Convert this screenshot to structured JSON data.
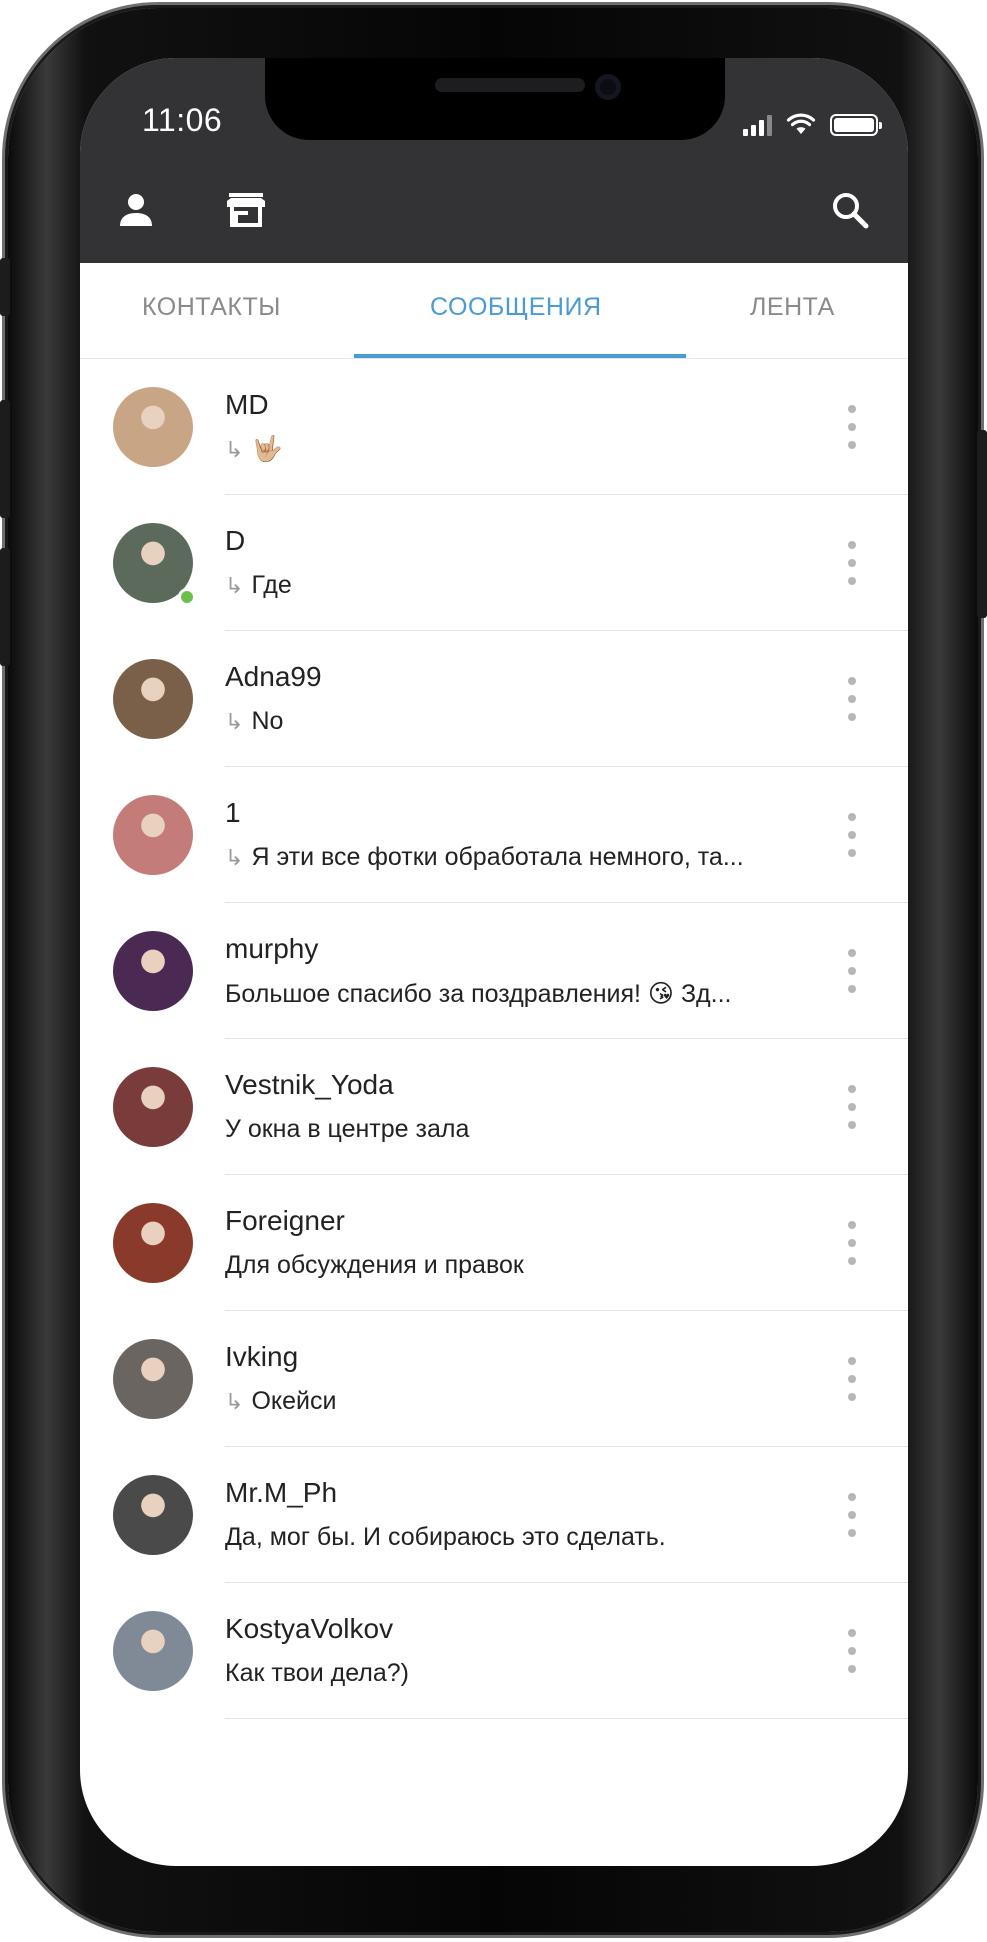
{
  "status_bar": {
    "time": "11:06"
  },
  "toolbar": {
    "profile_icon": "person-icon",
    "store_icon": "store-icon",
    "search_icon": "search-icon"
  },
  "tabs": [
    {
      "label": "КОНТАКТЫ",
      "active": false
    },
    {
      "label": "СООБЩЕНИЯ",
      "active": true
    },
    {
      "label": "ЛЕНТА",
      "active": false
    }
  ],
  "accent_color": "#4a9ad4",
  "chats": [
    {
      "name": "MD",
      "reply": true,
      "preview": "🤟🏼",
      "online": false,
      "avatar_color": "#c8a585"
    },
    {
      "name": "D",
      "reply": true,
      "preview": "Где",
      "online": true,
      "avatar_color": "#5b6a5a"
    },
    {
      "name": "Adna99",
      "reply": true,
      "preview": "No",
      "online": false,
      "avatar_color": "#7a6048"
    },
    {
      "name": "1",
      "reply": true,
      "preview": "Я эти все фотки обработала немного, та...",
      "online": false,
      "avatar_color": "#c47c78"
    },
    {
      "name": "murphy",
      "reply": false,
      "preview": "Большое спасибо за поздравления! 😘 Зд...",
      "online": false,
      "avatar_color": "#4a2a52"
    },
    {
      "name": "Vestnik_Yoda",
      "reply": false,
      "preview": "У окна в центре зала",
      "online": false,
      "avatar_color": "#7a3b3b"
    },
    {
      "name": "Foreigner",
      "reply": false,
      "preview": "Для обсуждения и правок",
      "online": false,
      "avatar_color": "#8a3a2a"
    },
    {
      "name": "Ivking",
      "reply": true,
      "preview": "Окейси",
      "online": false,
      "avatar_color": "#6a6560"
    },
    {
      "name": "Mr.M_Ph",
      "reply": false,
      "preview": "Да, мог бы. И собираюсь это сделать.",
      "online": false,
      "avatar_color": "#4a4a4a"
    },
    {
      "name": "KostyaVolkov",
      "reply": false,
      "preview": "Как твои дела?)",
      "online": false,
      "avatar_color": "#7f8a96"
    }
  ]
}
